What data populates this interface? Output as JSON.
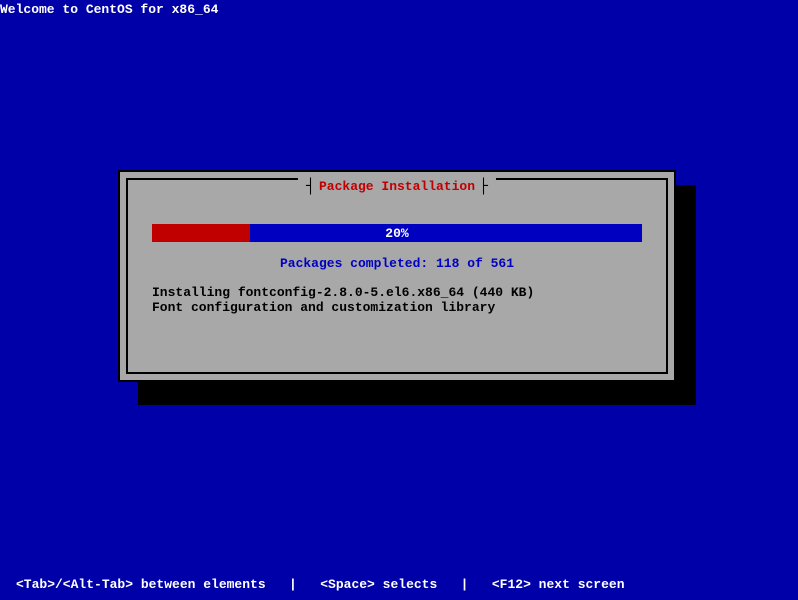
{
  "header": {
    "welcome_text": "Welcome to CentOS for x86_64"
  },
  "dialog": {
    "title": "Package Installation",
    "progress_percent": 20,
    "progress_text": "20%",
    "packages_completed": "Packages completed: 118 of 561",
    "installing_text": "Installing fontconfig-2.8.0-5.el6.x86_64 (440 KB)",
    "description_text": "Font configuration and customization library"
  },
  "footer": {
    "help_text": "<Tab>/<Alt-Tab> between elements   |   <Space> selects   |   <F12> next screen"
  }
}
